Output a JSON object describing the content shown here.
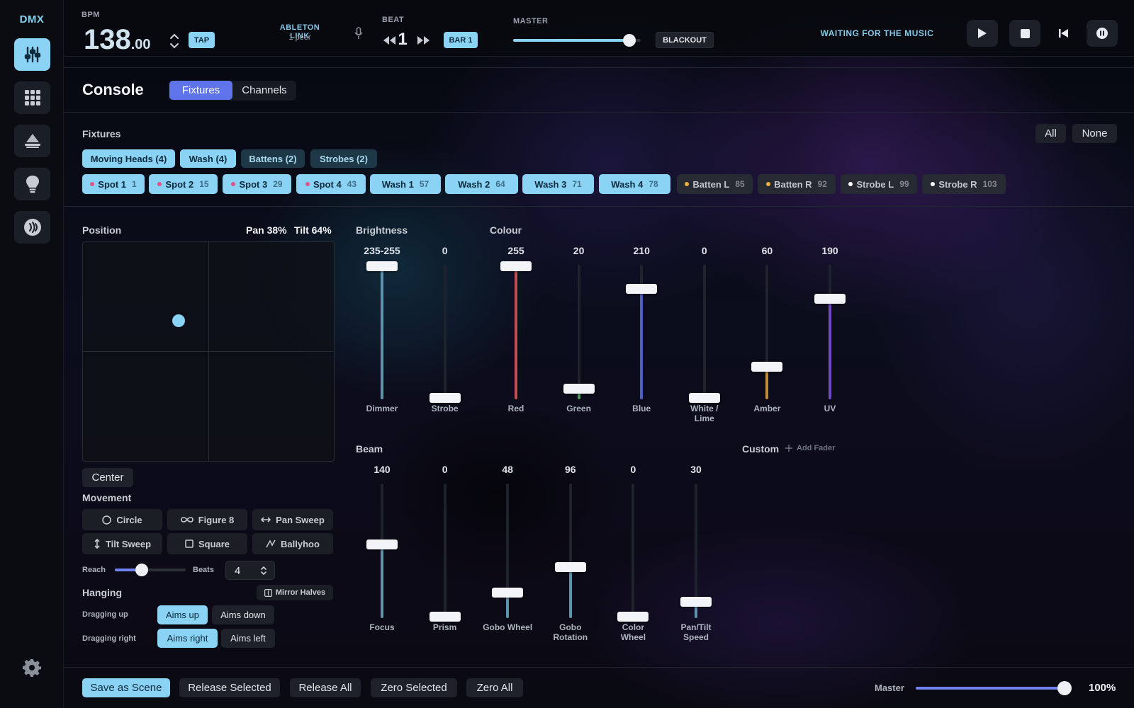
{
  "app": {
    "logo": "DMX"
  },
  "sidebar": {
    "icons": [
      "mixer-icon",
      "grid-icon",
      "sequence-icon",
      "bulb-icon",
      "audio-icon",
      "gear-icon"
    ]
  },
  "topbar": {
    "bpm_label": "BPM",
    "bpm_int": "138",
    "bpm_dec": ".00",
    "tap": "TAP",
    "link_title": "ABLETON LINK",
    "link_peers": "1 peer",
    "beat_label": "BEAT",
    "beat_value": "1",
    "bar": "BAR 1",
    "master_label": "MASTER",
    "master_level": 0.91,
    "blackout": "BLACKOUT",
    "status": "WAITING FOR THE MUSIC"
  },
  "console": {
    "title": "Console",
    "tabs": [
      "Fixtures",
      "Channels"
    ],
    "active_tab": "Fixtures"
  },
  "fixtures": {
    "title": "Fixtures",
    "all": "All",
    "none": "None",
    "groups": [
      {
        "label": "Moving Heads (4)",
        "on": true
      },
      {
        "label": "Wash (4)",
        "on": true
      },
      {
        "label": "Battens (2)",
        "on": false
      },
      {
        "label": "Strobes (2)",
        "on": false
      }
    ],
    "items": [
      {
        "name": "Spot 1",
        "num": "1",
        "on": true,
        "dot": "#e8508a"
      },
      {
        "name": "Spot 2",
        "num": "15",
        "on": true,
        "dot": "#e8508a"
      },
      {
        "name": "Spot 3",
        "num": "29",
        "on": true,
        "dot": "#e8508a"
      },
      {
        "name": "Spot 4",
        "num": "43",
        "on": true,
        "dot": "#e8508a"
      },
      {
        "name": "Wash 1",
        "num": "57",
        "on": true,
        "dot": ""
      },
      {
        "name": "Wash 2",
        "num": "64",
        "on": true,
        "dot": ""
      },
      {
        "name": "Wash 3",
        "num": "71",
        "on": true,
        "dot": ""
      },
      {
        "name": "Wash 4",
        "num": "78",
        "on": true,
        "dot": ""
      },
      {
        "name": "Batten L",
        "num": "85",
        "on": false,
        "dot": "#f0b040"
      },
      {
        "name": "Batten R",
        "num": "92",
        "on": false,
        "dot": "#f0b040"
      },
      {
        "name": "Strobe L",
        "num": "99",
        "on": false,
        "dot": "#ffffff"
      },
      {
        "name": "Strobe R",
        "num": "103",
        "on": false,
        "dot": "#ffffff"
      }
    ]
  },
  "position": {
    "title": "Position",
    "pan_label": "Pan 38%",
    "tilt_label": "Tilt 64%",
    "pan": 0.38,
    "tilt": 0.64,
    "center": "Center"
  },
  "movement": {
    "title": "Movement",
    "buttons": [
      "Circle",
      "Figure 8",
      "Pan Sweep",
      "Tilt Sweep",
      "Square",
      "Ballyhoo"
    ],
    "reach_label": "Reach",
    "reach": 0.38,
    "beats_label": "Beats",
    "beats": "4"
  },
  "hanging": {
    "title": "Hanging",
    "mirror": "Mirror Halves",
    "up_label": "Dragging up",
    "up_opts": [
      "Aims up",
      "Aims down"
    ],
    "right_label": "Dragging right",
    "right_opts": [
      "Aims right",
      "Aims left"
    ]
  },
  "brightness": {
    "title": "Brightness",
    "faders": [
      {
        "label": "Dimmer",
        "value": "235-255",
        "level": 1.0,
        "color": "#5d93ad"
      },
      {
        "label": "Strobe",
        "value": "0",
        "level": 0,
        "color": "#5d93ad"
      }
    ]
  },
  "colour": {
    "title": "Colour",
    "faders": [
      {
        "label": "Red",
        "value": "255",
        "level": 1.0,
        "color": "#c05050"
      },
      {
        "label": "Green",
        "value": "20",
        "level": 0.08,
        "color": "#4e9a5c"
      },
      {
        "label": "Blue",
        "value": "210",
        "level": 0.82,
        "color": "#4f5fc0"
      },
      {
        "label": "White / Lime",
        "value": "0",
        "level": 0,
        "color": "#6a7080"
      },
      {
        "label": "Amber",
        "value": "60",
        "level": 0.24,
        "color": "#c08a3a"
      },
      {
        "label": "UV",
        "value": "190",
        "level": 0.75,
        "color": "#7048c0"
      }
    ]
  },
  "beam": {
    "title": "Beam",
    "faders": [
      {
        "label": "Focus",
        "value": "140",
        "level": 0.55,
        "color": "#5d93ad"
      },
      {
        "label": "Prism",
        "value": "0",
        "level": 0,
        "color": "#5d93ad"
      },
      {
        "label": "Gobo Wheel",
        "value": "48",
        "level": 0.19,
        "color": "#5d93ad"
      },
      {
        "label": "Gobo Rotation",
        "value": "96",
        "level": 0.38,
        "color": "#5d93ad"
      },
      {
        "label": "Color Wheel",
        "value": "0",
        "level": 0,
        "color": "#5d93ad"
      },
      {
        "label": "Pan/Tilt Speed",
        "value": "30",
        "level": 0.12,
        "color": "#5d93ad"
      }
    ]
  },
  "custom": {
    "title": "Custom",
    "add": "Add Fader"
  },
  "footer": {
    "buttons": [
      "Save as Scene",
      "Release Selected",
      "Release All",
      "Zero Selected",
      "Zero All"
    ],
    "master_label": "Master",
    "master_value": "100%",
    "master_level": 1.0
  }
}
